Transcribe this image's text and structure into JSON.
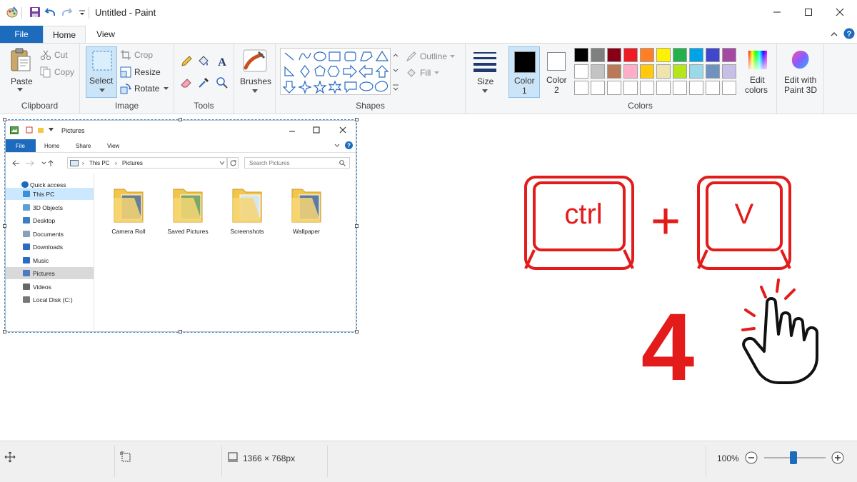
{
  "window": {
    "title": "Untitled - Paint"
  },
  "tabs": {
    "file": "File",
    "home": "Home",
    "view": "View"
  },
  "ribbon": {
    "clipboard": {
      "paste": "Paste",
      "cut": "Cut",
      "copy": "Copy",
      "group": "Clipboard"
    },
    "image": {
      "select": "Select",
      "crop": "Crop",
      "resize": "Resize",
      "rotate": "Rotate",
      "group": "Image"
    },
    "tools": {
      "group": "Tools"
    },
    "brushes": {
      "label": "Brushes"
    },
    "shapes": {
      "outline": "Outline",
      "fill": "Fill",
      "group": "Shapes"
    },
    "size": {
      "label": "Size"
    },
    "colors": {
      "color1_line1": "Color",
      "color1_line2": "1",
      "color2_line1": "Color",
      "color2_line2": "2",
      "edit_line1": "Edit",
      "edit_line2": "colors",
      "group": "Colors",
      "color1_value": "#000000",
      "color2_value": "#ffffff",
      "palette_row1": [
        "#000000",
        "#7f7f7f",
        "#880015",
        "#ed1c24",
        "#ff7f27",
        "#fff200",
        "#22b14c",
        "#00a2e8",
        "#3f48cc",
        "#a349a4"
      ],
      "palette_row2": [
        "#ffffff",
        "#c3c3c3",
        "#b97a57",
        "#ffaec9",
        "#ffc90e",
        "#efe4b0",
        "#b5e61d",
        "#99d9ea",
        "#7092be",
        "#c8bfe7"
      ]
    },
    "paint3d": {
      "line1": "Edit with",
      "line2": "Paint 3D"
    }
  },
  "explorer": {
    "title": "Pictures",
    "tabs": {
      "file": "File",
      "home": "Home",
      "share": "Share",
      "view": "View"
    },
    "path": {
      "this_pc": "This PC",
      "pictures": "Pictures"
    },
    "search_placeholder": "Search Pictures",
    "nav": [
      "Quick access",
      "This PC",
      "3D Objects",
      "Desktop",
      "Documents",
      "Downloads",
      "Music",
      "Pictures",
      "Videos",
      "Local Disk (C:)"
    ],
    "folders": [
      "Camera Roll",
      "Saved Pictures",
      "Screenshots",
      "Wallpaper"
    ]
  },
  "overlay": {
    "key1": "ctrl",
    "plus": "+",
    "key2": "V",
    "step": "4"
  },
  "status": {
    "dimensions": "1366 × 768px",
    "zoom": "100%",
    "zoom_slider_percent": 100
  }
}
